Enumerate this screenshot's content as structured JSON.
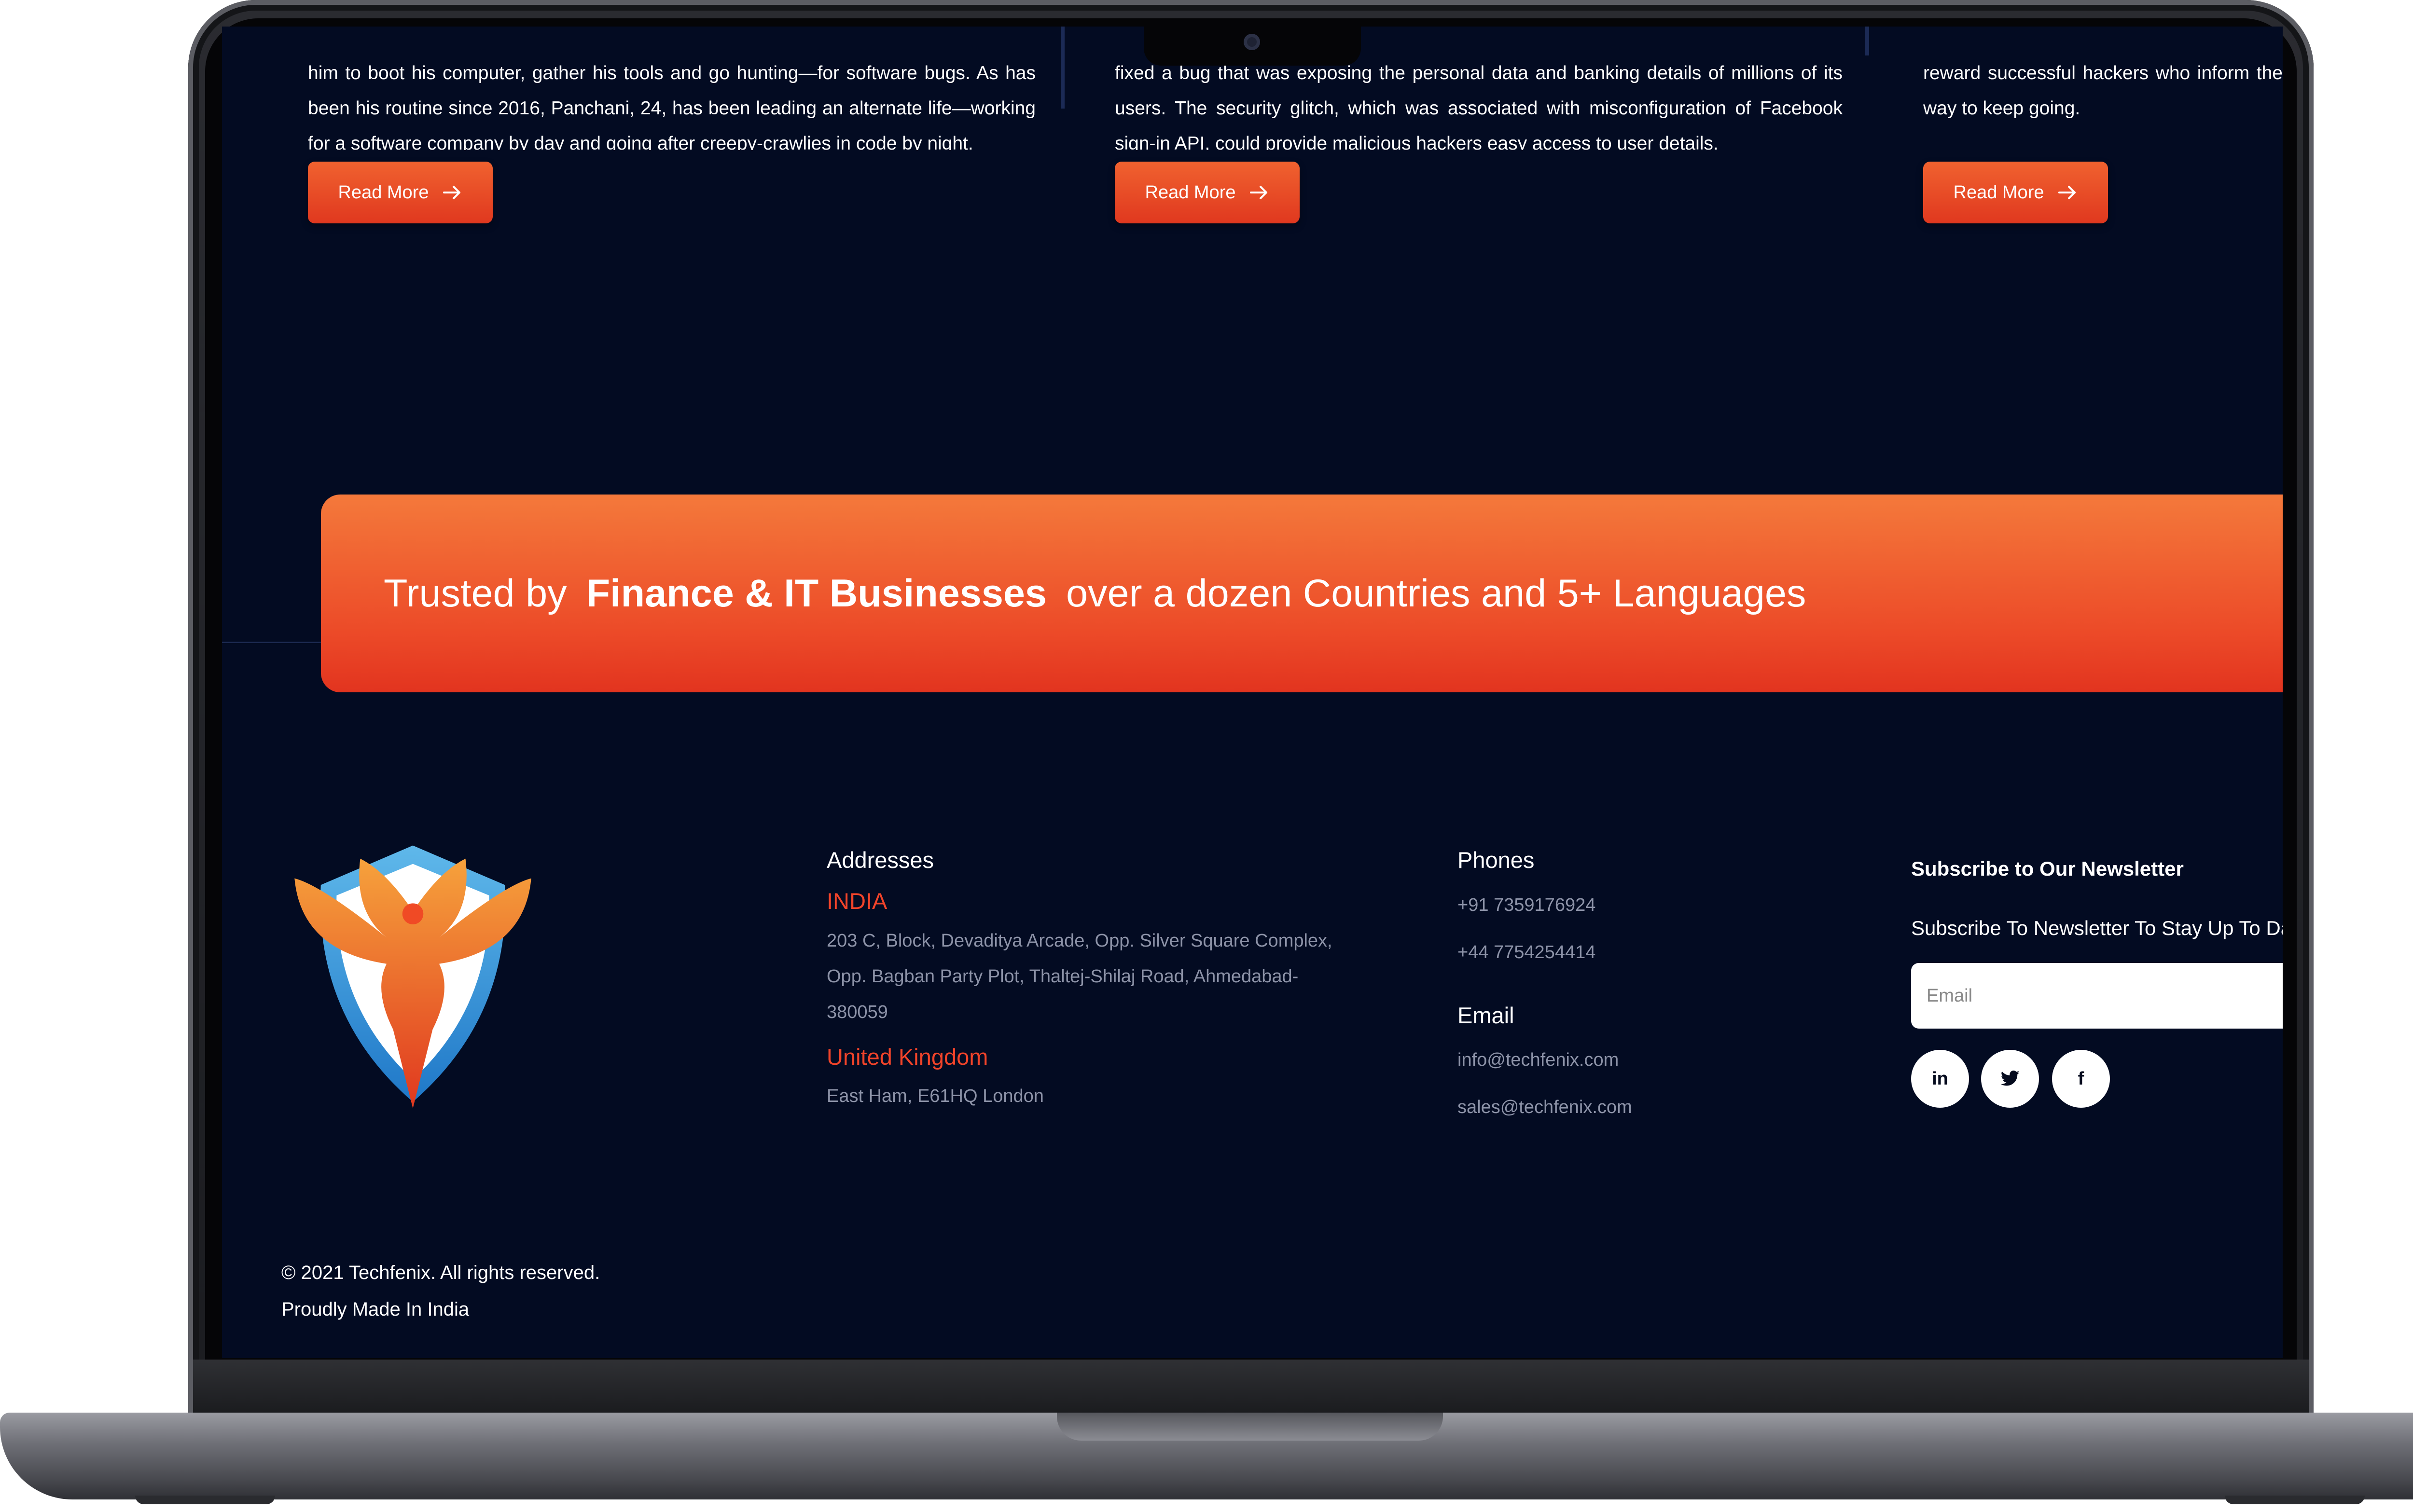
{
  "blog": {
    "posts": [
      {
        "excerpt": "him to boot his computer, gather his tools and go hunting—for software bugs. As has been his routine since 2016, Panchani, 24, has been leading an alternate life—working for a software company by day and going after creepy-crawlies in code by night.",
        "button_label": "Read More"
      },
      {
        "excerpt": "fixed a bug that was exposing the personal data and banking details of millions of its users. The security glitch, which was associated with misconfiguration of Facebook sign-in API, could provide malicious hackers easy access to user details.",
        "button_label": "Read More"
      },
      {
        "excerpt": "reward successful hackers who inform the way to keep going.",
        "button_label": "Read More"
      }
    ]
  },
  "banner": {
    "prefix": "Trusted by",
    "highlight": "Finance & IT Businesses",
    "suffix": "over a dozen Countries and 5+ Languages"
  },
  "footer": {
    "addresses": {
      "heading": "Addresses",
      "india_label": "INDIA",
      "india_lines": [
        "203 C, Block, Devaditya Arcade, Opp. Silver Square Complex,",
        "Opp. Bagban Party Plot, Thaltej-Shilaj Road, Ahmedabad-",
        "380059"
      ],
      "uk_label": "United Kingdom",
      "uk_line": "East Ham, E61HQ London"
    },
    "phones": {
      "heading": "Phones",
      "numbers": [
        "+91 7359176924",
        "+44 7754254414"
      ]
    },
    "email": {
      "heading": "Email",
      "addresses": [
        "info@techfenix.com",
        "sales@techfenix.com"
      ]
    },
    "newsletter": {
      "title": "Subscribe to Our Newsletter",
      "subtitle": "Subscribe To Newsletter To Stay Up To Date",
      "email_placeholder": "Email"
    },
    "social": [
      {
        "icon": "linkedin-icon",
        "glyph": "in"
      },
      {
        "icon": "twitter-icon",
        "glyph": ""
      },
      {
        "icon": "facebook-icon",
        "glyph": "f"
      }
    ],
    "copyright": "© 2021 Techfenix. All rights reserved.",
    "made_in": "Proudly Made In India"
  },
  "colors": {
    "page_background": "#030b22",
    "accent_orange": "#f0622f",
    "accent_red": "#e0381f",
    "location_red": "#f2442a",
    "muted_text": "#8d93a8"
  }
}
